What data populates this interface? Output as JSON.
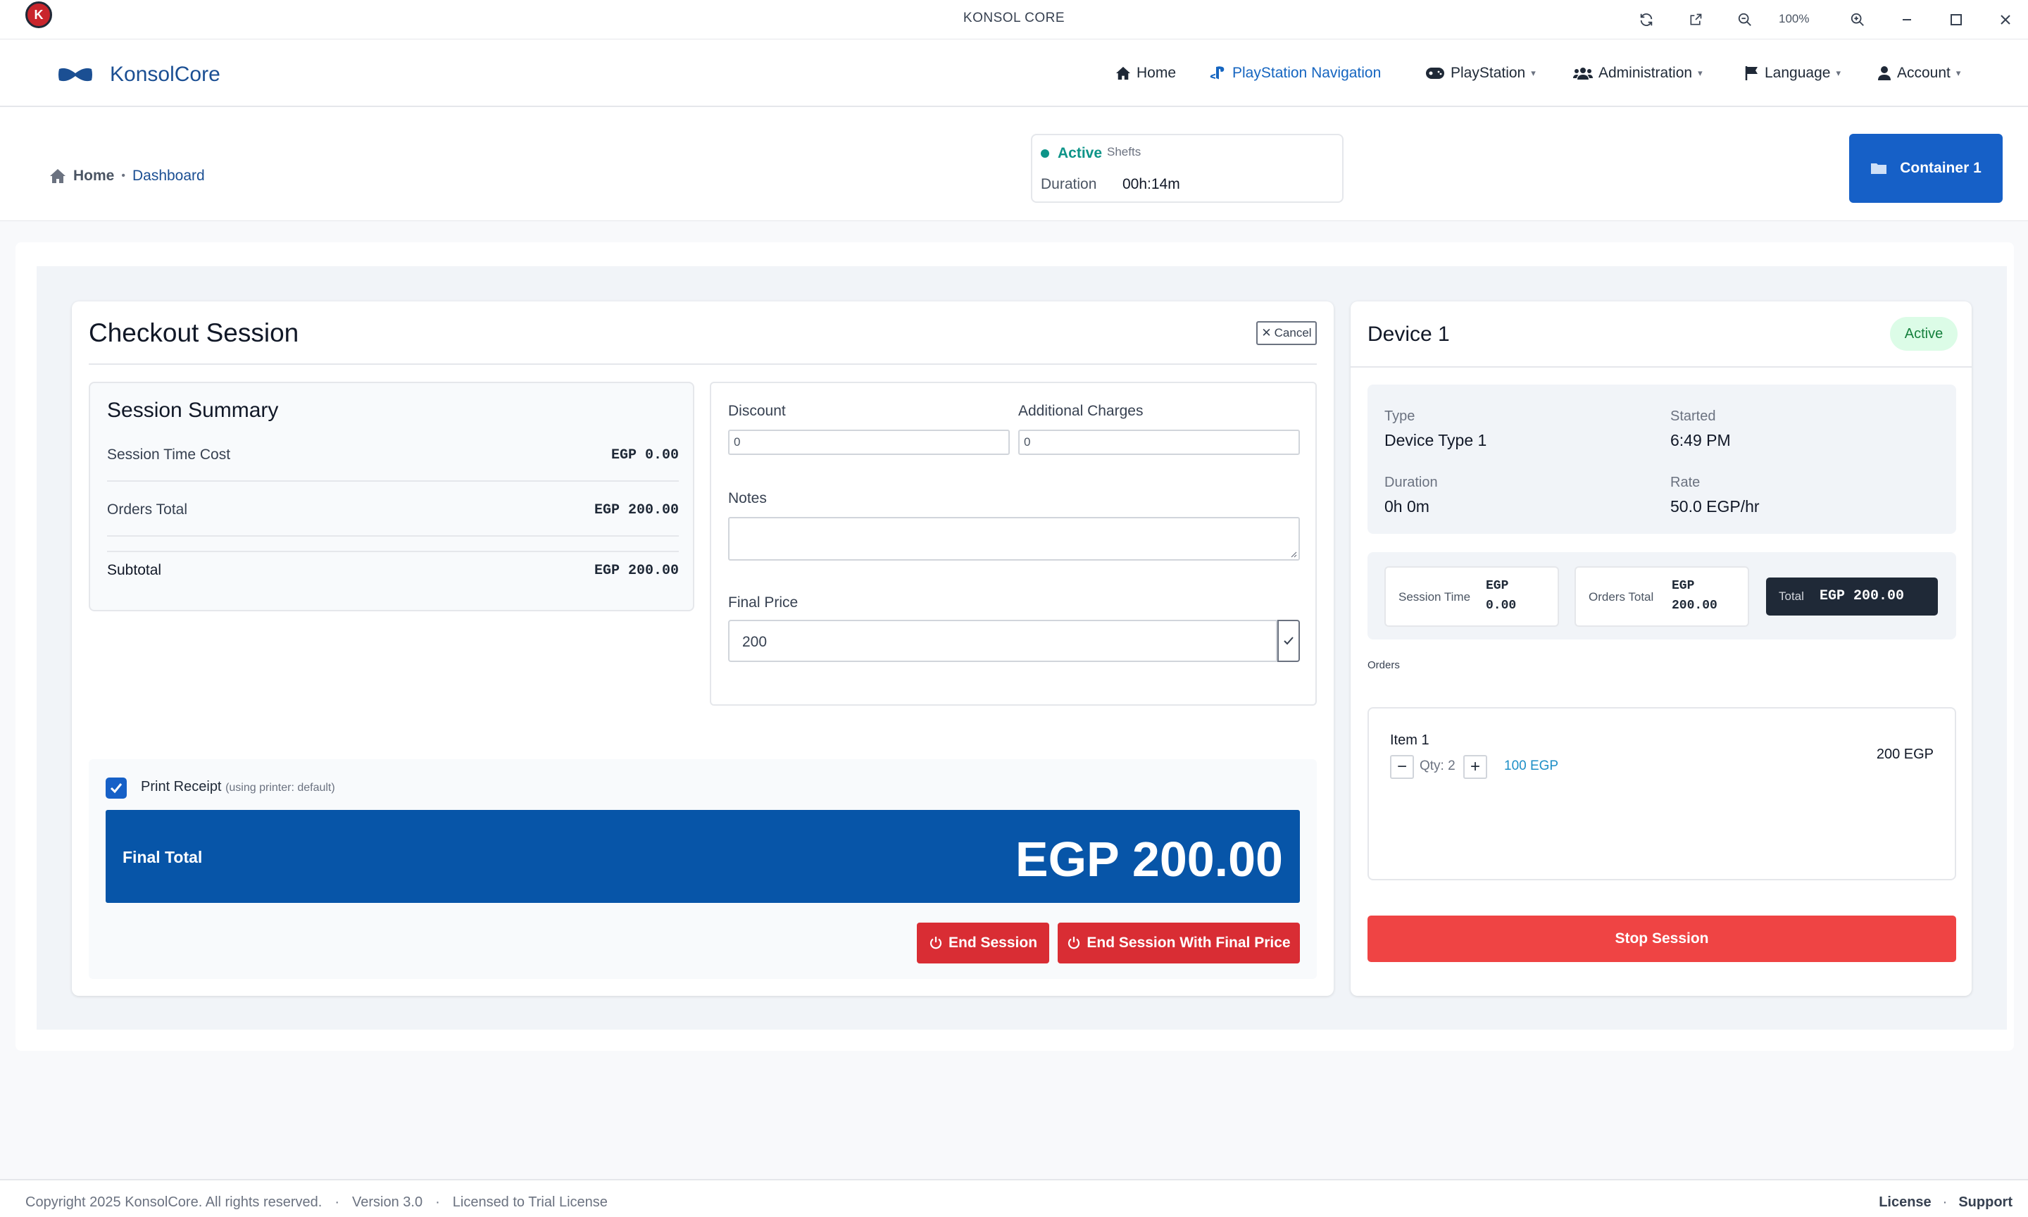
{
  "window": {
    "title": "KONSOL CORE",
    "zoom": "100%",
    "logo_letter": "K"
  },
  "navbar": {
    "brand": "KonsolCore",
    "items": [
      {
        "label": "Home",
        "icon": "home-icon"
      },
      {
        "label": "PlayStation Navigation",
        "icon": "playstation-icon"
      },
      {
        "label": "PlayStation",
        "icon": "gamepad-icon",
        "dropdown": true
      },
      {
        "label": "Administration",
        "icon": "users-icon",
        "dropdown": true
      },
      {
        "label": "Language",
        "icon": "flag-icon",
        "dropdown": true
      },
      {
        "label": "Account",
        "icon": "user-icon",
        "dropdown": true
      }
    ]
  },
  "breadcrumb": {
    "home": "Home",
    "separator": "•",
    "current": "Dashboard"
  },
  "shift": {
    "status": "Active",
    "label": "Shefts",
    "duration_label": "Duration",
    "duration_value": "00h:14m"
  },
  "container_button": "Container 1",
  "checkout": {
    "title": "Checkout Session",
    "cancel": "Cancel",
    "summary": {
      "title": "Session Summary",
      "rows": [
        {
          "label": "Session Time Cost",
          "value": "EGP 0.00"
        },
        {
          "label": "Orders Total",
          "value": "EGP 200.00"
        },
        {
          "label": "Subtotal",
          "value": "EGP 200.00"
        }
      ]
    },
    "discount_label": "Discount",
    "discount_value": "0",
    "charges_label": "Additional Charges",
    "charges_value": "0",
    "notes_label": "Notes",
    "final_price_label": "Final Price",
    "final_price_value": "200",
    "print_receipt": "Print Receipt",
    "print_receipt_note": "(using printer: default)",
    "print_receipt_checked": true,
    "final_total_label": "Final Total",
    "final_total_value": "EGP 200.00",
    "end_session": "End Session",
    "end_session_final": "End Session With Final Price"
  },
  "device": {
    "title": "Device 1",
    "status": "Active",
    "type_label": "Type",
    "type_value": "Device Type 1",
    "started_label": "Started",
    "started_value": "6:49 PM",
    "duration_label": "Duration",
    "duration_value": "0h 0m",
    "rate_label": "Rate",
    "rate_value": "50.0 EGP/hr",
    "session_time_label": "Session Time",
    "session_time_currency": "EGP",
    "session_time_amount": "0.00",
    "orders_total_label": "Orders Total",
    "orders_total_currency": "EGP",
    "orders_total_amount": "200.00",
    "total_label": "Total",
    "total_value": "EGP 200.00",
    "orders_heading": "Orders",
    "orders": [
      {
        "name": "Item 1",
        "qty": "Qty: 2",
        "unit_price": "100 EGP",
        "line_total": "200 EGP"
      }
    ],
    "stop_session": "Stop Session"
  },
  "footer": {
    "copyright": "Copyright 2025 KonsolCore. All rights reserved.",
    "sep": "·",
    "version": "Version 3.0",
    "license_info": "Licensed to Trial License",
    "license_link": "License",
    "support_link": "Support",
    "right_sep": "·"
  },
  "colors": {
    "primary": "#1660c7",
    "final_total_bg": "#0755a8",
    "danger": "#d92d34",
    "stop": "#ef4444",
    "active_green": "#15803d"
  }
}
